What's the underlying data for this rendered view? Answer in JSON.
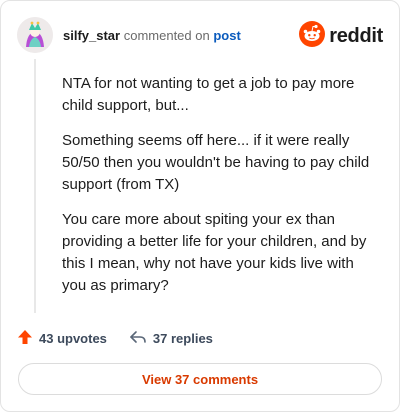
{
  "header": {
    "username": "silfy_star",
    "action_text": "commented on",
    "post_link": "post",
    "brand": "reddit"
  },
  "comment": {
    "paragraphs": [
      "NTA for not wanting to get a job to pay more child support, but...",
      "Something seems off here... if it were really 50/50 then you wouldn't be having to pay child support (from TX)",
      "You care more about spiting your ex than providing a better life for your children, and by this I mean, why not have your kids live with you as primary?"
    ]
  },
  "actions": {
    "upvotes": "43 upvotes",
    "replies": "37 replies"
  },
  "view_comments_label": "View 37 comments",
  "colors": {
    "brand_orange": "#ff4500",
    "view_button_text": "#d93a00",
    "post_link": "#0b5bbd"
  },
  "icons": [
    "avatar",
    "reddit-logo-icon",
    "upvote-arrow-icon",
    "reply-arrow-icon"
  ]
}
